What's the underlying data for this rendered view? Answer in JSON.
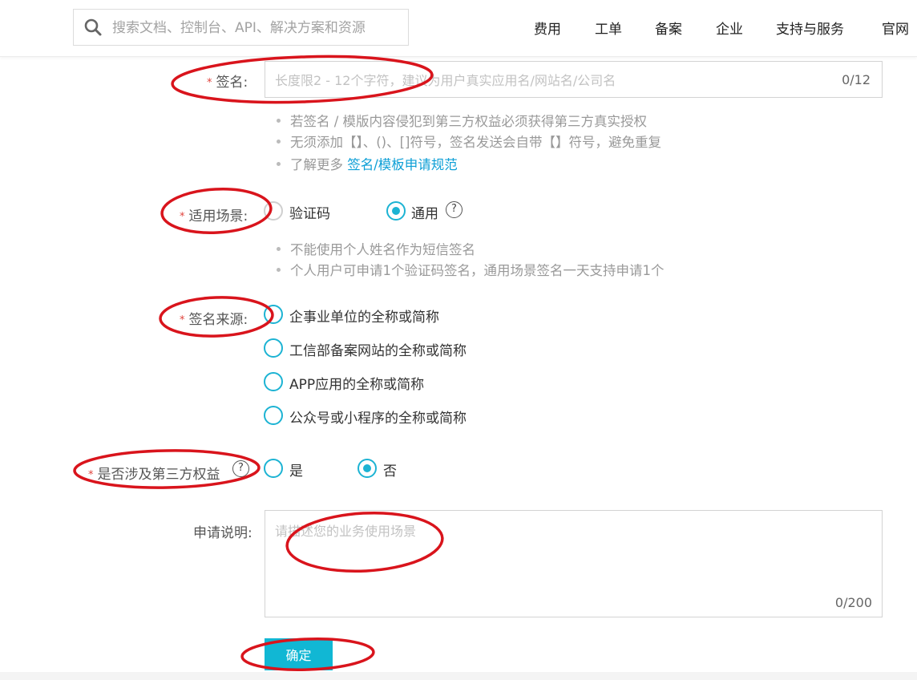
{
  "search": {
    "placeholder": "搜索文档、控制台、API、解决方案和资源",
    "icon": "search-icon"
  },
  "nav": [
    "费用",
    "工单",
    "备案",
    "企业",
    "支持与服务",
    "官网"
  ],
  "signature": {
    "label": "签名:",
    "placeholder": "长度限2 - 12个字符，建议为用户真实应用名/网站名/公司名",
    "counter": "0/12",
    "hints": [
      "若签名 / 模版内容侵犯到第三方权益必须获得第三方真实授权",
      "无须添加【】、()、[]符号，签名发送会自带【】符号，避免重复"
    ],
    "learn_more_prefix": "了解更多 ",
    "learn_more_link": "签名/模板申请规范"
  },
  "scenario": {
    "label": "适用场景:",
    "options": [
      "验证码",
      "通用"
    ],
    "selected": "通用",
    "hints": [
      "不能使用个人姓名作为短信签名",
      "个人用户可申请1个验证码签名，通用场景签名一天支持申请1个"
    ]
  },
  "source": {
    "label": "签名来源:",
    "options": [
      "企事业单位的全称或简称",
      "工信部备案网站的全称或简称",
      "APP应用的全称或简称",
      "公众号或小程序的全称或简称"
    ]
  },
  "third_party": {
    "label": "是否涉及第三方权益",
    "options": [
      "是",
      "否"
    ],
    "selected": "否"
  },
  "description": {
    "label": "申请说明:",
    "placeholder": "请描述您的业务使用场景",
    "counter": "0/200"
  },
  "submit_label": "确定",
  "required_mark": "*",
  "help_glyph": "?",
  "colors": {
    "accent": "#11b7d4",
    "required": "#e0433c",
    "annotation": "#d9141c",
    "link": "#0d9fd6"
  }
}
